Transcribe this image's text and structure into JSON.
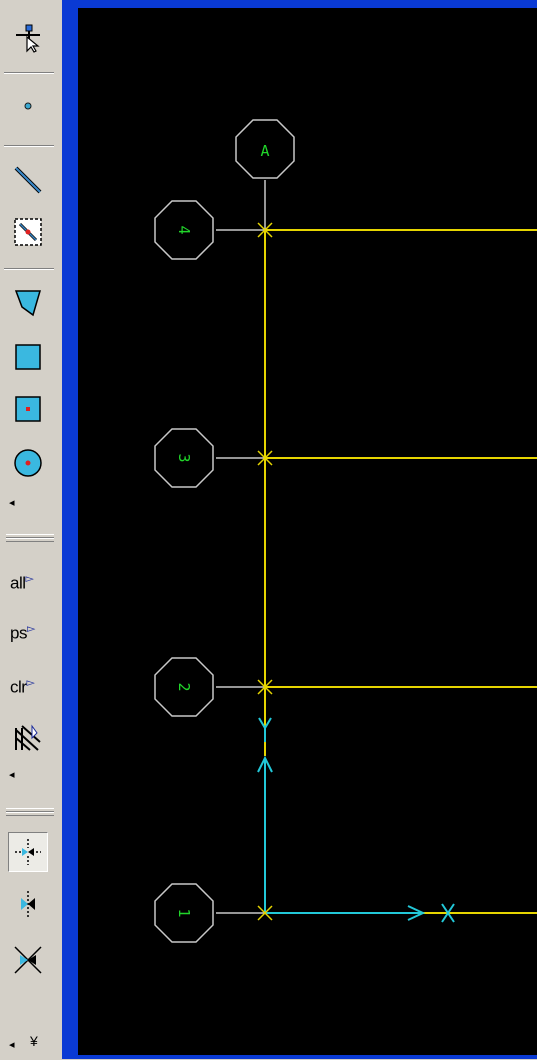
{
  "toolbar": {
    "buttons": [
      {
        "name": "select-pointer-icon"
      },
      {
        "name": "point-icon"
      },
      {
        "name": "line-icon"
      },
      {
        "name": "line-select-box-icon"
      },
      {
        "name": "polygon-icon"
      },
      {
        "name": "rectangle-icon"
      },
      {
        "name": "rectangle-center-icon"
      },
      {
        "name": "circle-center-icon"
      }
    ],
    "select_all_label": "all",
    "select_ps_label": "ps",
    "select_clr_label": "clr",
    "more_arrow": "◂",
    "overflow_chevron": "¥"
  },
  "colors": {
    "canvas_bg": "#000000",
    "grid_line": "#e6d500",
    "member_line": "#22c8d8",
    "bubble_text": "#21d52a",
    "bubble_outline": "#c8c8c8",
    "window_frame": "#0a3ad4"
  },
  "drawing": {
    "column_bubble": "A",
    "row_bubbles": [
      "4",
      "3",
      "2",
      "1"
    ]
  }
}
